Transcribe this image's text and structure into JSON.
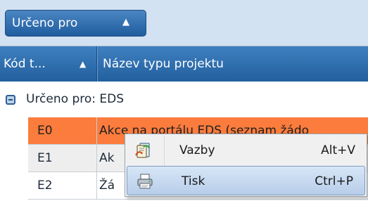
{
  "group_panel": {
    "chip_label": "Určeno pro",
    "chip_sort_arrow": "▲"
  },
  "columns": {
    "code_header": "Kód t...",
    "code_sort_arrow": "▲",
    "name_header": "Název typu projektu"
  },
  "group": {
    "label": "Určeno pro: EDS"
  },
  "rows": [
    {
      "code": "E0",
      "name": "Akce na portálu EDS (seznam žádo",
      "selected": true
    },
    {
      "code": "E1",
      "name": "Ak",
      "selected": false
    },
    {
      "code": "E2",
      "name": "Žá",
      "selected": false
    }
  ],
  "context_menu": {
    "items": [
      {
        "label": "Vazby",
        "shortcut": "Alt+V",
        "icon": "links-icon",
        "highlighted": false
      },
      {
        "label": "Tisk",
        "shortcut": "Ctrl+P",
        "icon": "printer-icon",
        "highlighted": true
      }
    ]
  },
  "colors": {
    "header_blue": "#225f9e",
    "selected_row": "#fb7c3d",
    "menu_highlight": "#b7cde9"
  }
}
